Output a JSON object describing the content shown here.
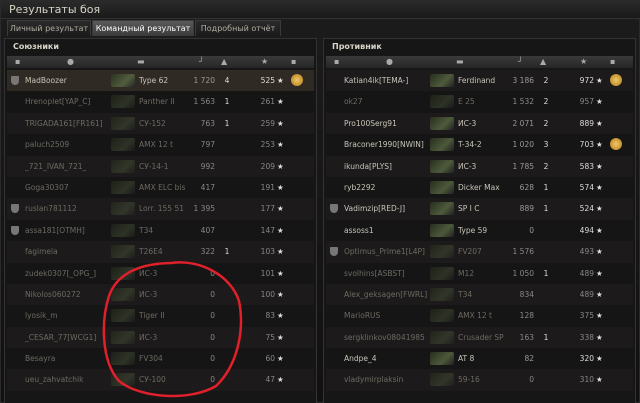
{
  "window": {
    "title": "Результаты боя"
  },
  "tabs": [
    {
      "label": "Личный результат"
    },
    {
      "label": "Командный результат"
    },
    {
      "label": "Подробный отчёт"
    }
  ],
  "allies": {
    "title": "Союзники",
    "rows": [
      {
        "name": "MadBoozer",
        "tank": "Type 62",
        "damage": "1 720",
        "kills": "4",
        "xp": "525",
        "star": "★",
        "medal": true,
        "shield": true,
        "dead": false,
        "me": true
      },
      {
        "name": "Hrenoplet[YAP_C]",
        "tank": "Panther II",
        "damage": "1 563",
        "kills": "1",
        "xp": "261",
        "star": "★",
        "medal": false,
        "shield": false,
        "dead": true
      },
      {
        "name": "TRIGADA161[FR161]",
        "tank": "СУ-152",
        "damage": "763",
        "kills": "1",
        "xp": "259",
        "star": "★",
        "medal": false,
        "shield": false,
        "dead": true
      },
      {
        "name": "paluch2509",
        "tank": "AMX 12 t",
        "damage": "797",
        "kills": "",
        "xp": "253",
        "star": "★",
        "medal": false,
        "shield": false,
        "dead": true
      },
      {
        "name": "_721_IVAN_721_",
        "tank": "СУ-14-1",
        "damage": "992",
        "kills": "",
        "xp": "209",
        "star": "★",
        "medal": false,
        "shield": false,
        "dead": true
      },
      {
        "name": "Goga30307",
        "tank": "AMX ELC bis",
        "damage": "417",
        "kills": "",
        "xp": "191",
        "star": "★",
        "medal": false,
        "shield": false,
        "dead": true
      },
      {
        "name": "ruslan781112",
        "tank": "Lorr. 155 51",
        "damage": "1 395",
        "kills": "",
        "xp": "177",
        "star": "★",
        "medal": false,
        "shield": true,
        "dead": true
      },
      {
        "name": "assa181[OTMH]",
        "tank": "T34",
        "damage": "407",
        "kills": "",
        "xp": "147",
        "star": "★",
        "medal": false,
        "shield": true,
        "dead": true
      },
      {
        "name": "fagimela",
        "tank": "T26E4",
        "damage": "322",
        "kills": "1",
        "xp": "103",
        "star": "★",
        "medal": false,
        "shield": false,
        "dead": true
      },
      {
        "name": "zudek0307[_OPG_]",
        "tank": "ИС-3",
        "damage": "0",
        "kills": "",
        "xp": "101",
        "star": "★",
        "medal": false,
        "shield": false,
        "dead": true
      },
      {
        "name": "Nikolos060272",
        "tank": "ИС-3",
        "damage": "0",
        "kills": "",
        "xp": "100",
        "star": "★",
        "medal": false,
        "shield": false,
        "dead": true
      },
      {
        "name": "lyosik_m",
        "tank": "Tiger II",
        "damage": "0",
        "kills": "",
        "xp": "83",
        "star": "★",
        "medal": false,
        "shield": false,
        "dead": true
      },
      {
        "name": "_CESAR_77[WCG1]",
        "tank": "ИС-3",
        "damage": "0",
        "kills": "",
        "xp": "75",
        "star": "★",
        "medal": false,
        "shield": false,
        "dead": true
      },
      {
        "name": "Besayra",
        "tank": "FV304",
        "damage": "0",
        "kills": "",
        "xp": "60",
        "star": "★",
        "medal": false,
        "shield": false,
        "dead": true
      },
      {
        "name": "ueu_zahvatchik",
        "tank": "СУ-100",
        "damage": "0",
        "kills": "",
        "xp": "47",
        "star": "★",
        "medal": false,
        "shield": false,
        "dead": true
      }
    ]
  },
  "enemies": {
    "title": "Противник",
    "rows": [
      {
        "name": "Katian4ik[TEMA-]",
        "tank": "Ferdinand",
        "damage": "3 186",
        "kills": "2",
        "xp": "972",
        "star": "★",
        "medal": true,
        "shield": false,
        "dead": false
      },
      {
        "name": "ok27",
        "tank": "E 25",
        "damage": "1 532",
        "kills": "2",
        "xp": "957",
        "star": "★",
        "medal": false,
        "shield": false,
        "dead": true
      },
      {
        "name": "Pro100Serg91",
        "tank": "ИС-3",
        "damage": "2 071",
        "kills": "2",
        "xp": "889",
        "star": "★",
        "medal": false,
        "shield": false,
        "dead": false
      },
      {
        "name": "Braconer1990[NWIN]",
        "tank": "T-34-2",
        "damage": "1 020",
        "kills": "3",
        "xp": "703",
        "star": "★",
        "medal": true,
        "shield": false,
        "dead": false
      },
      {
        "name": "ikunda[PLYS]",
        "tank": "ИС-3",
        "damage": "1 785",
        "kills": "2",
        "xp": "583",
        "star": "★",
        "medal": false,
        "shield": false,
        "dead": false
      },
      {
        "name": "ryb2292",
        "tank": "Dicker Max",
        "damage": "628",
        "kills": "1",
        "xp": "574",
        "star": "★",
        "medal": false,
        "shield": false,
        "dead": false
      },
      {
        "name": "Vadimzip[RED-J]",
        "tank": "SP I C",
        "damage": "889",
        "kills": "1",
        "xp": "524",
        "star": "★",
        "medal": false,
        "shield": true,
        "dead": false
      },
      {
        "name": "assoss1",
        "tank": "Type 59",
        "damage": "0",
        "kills": "",
        "xp": "494",
        "star": "★",
        "medal": false,
        "shield": false,
        "dead": false
      },
      {
        "name": "Optimus_Prime1[L4P]",
        "tank": "FV207",
        "damage": "1 576",
        "kills": "",
        "xp": "493",
        "star": "★",
        "medal": false,
        "shield": true,
        "dead": true
      },
      {
        "name": "svolhins[ASBST]",
        "tank": "M12",
        "damage": "1 050",
        "kills": "1",
        "xp": "489",
        "star": "★",
        "medal": false,
        "shield": false,
        "dead": true
      },
      {
        "name": "Alex_geksagen[FWRL]",
        "tank": "T34",
        "damage": "834",
        "kills": "",
        "xp": "489",
        "star": "★",
        "medal": false,
        "shield": false,
        "dead": true
      },
      {
        "name": "MarioRUS",
        "tank": "AMX 12 t",
        "damage": "128",
        "kills": "",
        "xp": "375",
        "star": "★",
        "medal": false,
        "shield": false,
        "dead": true
      },
      {
        "name": "sergklinkov08041985",
        "tank": "Crusader SP",
        "damage": "163",
        "kills": "1",
        "xp": "338",
        "star": "★",
        "medal": false,
        "shield": false,
        "dead": true
      },
      {
        "name": "Andpe_4",
        "tank": "AT 8",
        "damage": "82",
        "kills": "",
        "xp": "320",
        "star": "★",
        "medal": false,
        "shield": false,
        "dead": false
      },
      {
        "name": "vladymirplaksin",
        "tank": "59-16",
        "damage": "0",
        "kills": "",
        "xp": "310",
        "star": "★",
        "medal": false,
        "shield": false,
        "dead": true
      }
    ]
  },
  "header_icons": [
    "shield-icon",
    "person-icon",
    "tank-icon",
    "damage-icon",
    "kills-icon",
    "xp-icon",
    "star-icon"
  ],
  "annotation_color": "#e0202a"
}
